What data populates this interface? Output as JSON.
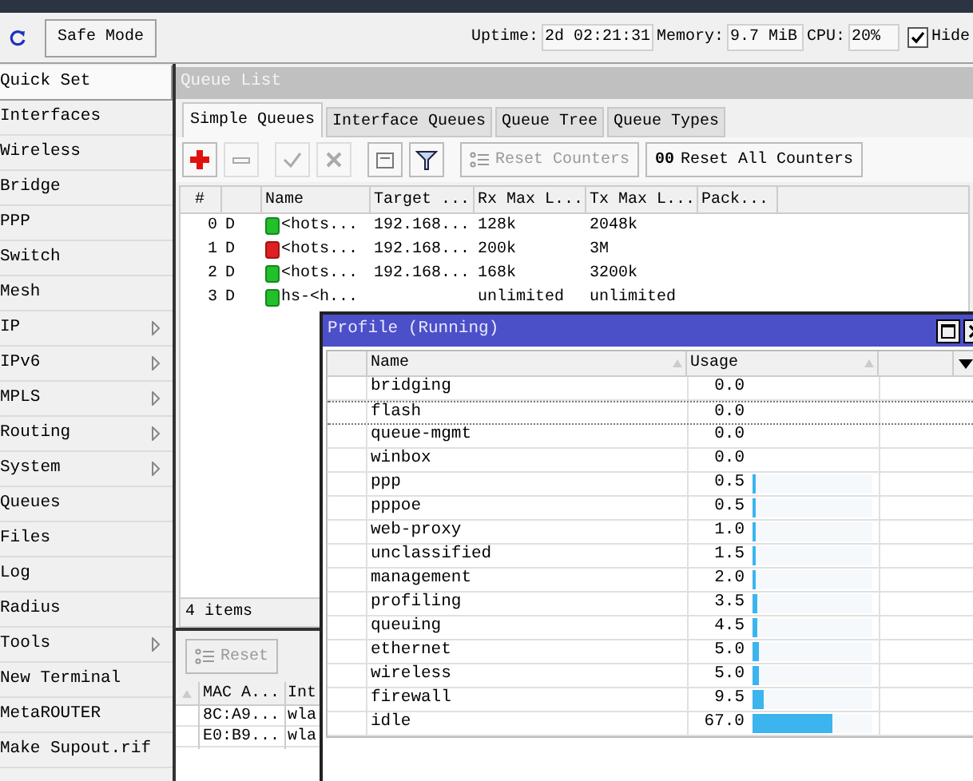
{
  "toolbar": {
    "safe_mode": "Safe Mode",
    "uptime_label": "Uptime:",
    "uptime": "2d 02:21:31",
    "memory_label": "Memory:",
    "memory": "9.7 MiB",
    "cpu_label": "CPU:",
    "cpu": "20%",
    "hide": {
      "label": "Hide",
      "checked": true
    }
  },
  "sidebar": {
    "items": [
      {
        "label": "Quick Set",
        "submenu": false,
        "selected": true
      },
      {
        "label": "Interfaces",
        "submenu": false,
        "selected": false
      },
      {
        "label": "Wireless",
        "submenu": false,
        "selected": false
      },
      {
        "label": "Bridge",
        "submenu": false,
        "selected": false
      },
      {
        "label": "PPP",
        "submenu": false,
        "selected": false
      },
      {
        "label": "Switch",
        "submenu": false,
        "selected": false
      },
      {
        "label": "Mesh",
        "submenu": false,
        "selected": false
      },
      {
        "label": "IP",
        "submenu": true,
        "selected": false
      },
      {
        "label": "IPv6",
        "submenu": true,
        "selected": false
      },
      {
        "label": "MPLS",
        "submenu": true,
        "selected": false
      },
      {
        "label": "Routing",
        "submenu": true,
        "selected": false
      },
      {
        "label": "System",
        "submenu": true,
        "selected": false
      },
      {
        "label": "Queues",
        "submenu": false,
        "selected": false
      },
      {
        "label": "Files",
        "submenu": false,
        "selected": false
      },
      {
        "label": "Log",
        "submenu": false,
        "selected": false
      },
      {
        "label": "Radius",
        "submenu": false,
        "selected": false
      },
      {
        "label": "Tools",
        "submenu": true,
        "selected": false
      },
      {
        "label": "New Terminal",
        "submenu": false,
        "selected": false
      },
      {
        "label": "MetaROUTER",
        "submenu": false,
        "selected": false
      },
      {
        "label": "Make Supout.rif",
        "submenu": false,
        "selected": false
      }
    ]
  },
  "queue_list": {
    "title": "Queue List",
    "tabs": [
      {
        "label": "Simple Queues",
        "selected": true
      },
      {
        "label": "Interface Queues",
        "selected": false
      },
      {
        "label": "Queue Tree",
        "selected": false
      },
      {
        "label": "Queue Types",
        "selected": false
      }
    ],
    "buttons": [
      {
        "kind": "add",
        "disabled": false
      },
      {
        "kind": "remove",
        "disabled": true
      },
      {
        "kind": "enable",
        "disabled": true
      },
      {
        "kind": "disable",
        "disabled": true
      },
      {
        "kind": "comment",
        "disabled": false
      },
      {
        "kind": "filter",
        "disabled": false
      },
      {
        "kind": "reset",
        "label": "Reset Counters",
        "disabled": true
      },
      {
        "kind": "reset-all",
        "icon_text": "00",
        "label": "Reset All Counters",
        "disabled": false
      }
    ],
    "table": {
      "columns": [
        "#",
        "",
        "Name",
        "Target ...",
        "Rx Max L...",
        "Tx Max L...",
        "Pack..."
      ],
      "rows": [
        {
          "index": "0",
          "flag": "D",
          "color": "#22c02a",
          "name": "<hots...",
          "target": "192.168...",
          "rx": "128k",
          "tx": "2048k"
        },
        {
          "index": "1",
          "flag": "D",
          "color": "#e02020",
          "name": "<hots...",
          "target": "192.168...",
          "rx": "200k",
          "tx": "3M"
        },
        {
          "index": "2",
          "flag": "D",
          "color": "#22c02a",
          "name": "<hots...",
          "target": "192.168...",
          "rx": "168k",
          "tx": "3200k"
        },
        {
          "index": "3",
          "flag": "D",
          "color": "#22c02a",
          "name": "hs-<h...",
          "target": "",
          "rx": "unlimited",
          "tx": "unlimited"
        }
      ]
    },
    "status": "4 items"
  },
  "lower_window": {
    "reset_button": {
      "label": "Reset",
      "disabled": true
    },
    "columns": [
      "MAC A...",
      "Int"
    ],
    "rows": [
      [
        "8C:A9...",
        "wla"
      ],
      [
        "E0:B9...",
        "wla"
      ]
    ]
  },
  "profile": {
    "title": "Profile (Running)",
    "columns": [
      "Name",
      "Usage"
    ],
    "rows": [
      {
        "name": "bridging",
        "usage": "0.0",
        "selected": false
      },
      {
        "name": "flash",
        "usage": "0.0",
        "selected": true
      },
      {
        "name": "queue-mgmt",
        "usage": "0.0",
        "selected": false
      },
      {
        "name": "winbox",
        "usage": "0.0",
        "selected": false
      },
      {
        "name": "ppp",
        "usage": "0.5",
        "level": 0.005,
        "selected": false
      },
      {
        "name": "pppoe",
        "usage": "0.5",
        "level": 0.005,
        "selected": false
      },
      {
        "name": "web-proxy",
        "usage": "1.0",
        "level": 0.01,
        "selected": false
      },
      {
        "name": "unclassified",
        "usage": "1.5",
        "level": 0.015,
        "selected": false
      },
      {
        "name": "management",
        "usage": "2.0",
        "level": 0.02,
        "selected": false
      },
      {
        "name": "profiling",
        "usage": "3.5",
        "level": 0.035,
        "selected": false
      },
      {
        "name": "queuing",
        "usage": "4.5",
        "level": 0.045,
        "selected": false
      },
      {
        "name": "ethernet",
        "usage": "5.0",
        "level": 0.05,
        "selected": false
      },
      {
        "name": "wireless",
        "usage": "5.0",
        "level": 0.05,
        "selected": false
      },
      {
        "name": "firewall",
        "usage": "9.5",
        "level": 0.095,
        "selected": false
      },
      {
        "name": "idle",
        "usage": "67.0",
        "level": 0.67,
        "selected": false
      }
    ]
  }
}
